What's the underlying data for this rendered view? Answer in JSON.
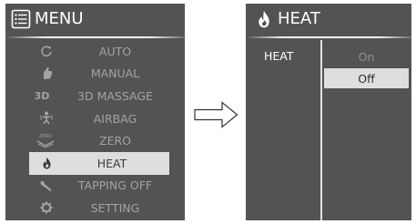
{
  "menu": {
    "title": "MENU",
    "items": [
      {
        "label": "AUTO",
        "icon": "auto-cycle-icon"
      },
      {
        "label": "MANUAL",
        "icon": "hand-icon"
      },
      {
        "label": "3D MASSAGE",
        "icon": "3d-icon",
        "icon_text": "3D"
      },
      {
        "label": "AIRBAG",
        "icon": "airbag-person-icon"
      },
      {
        "label": "ZERO",
        "icon": "zero-gravity-icon",
        "icon_text": "ZERO"
      },
      {
        "label": "HEAT",
        "icon": "flame-icon",
        "selected": true
      },
      {
        "label": "TAPPING OFF",
        "icon": "tapping-icon"
      },
      {
        "label": "SETTING",
        "icon": "gear-icon"
      }
    ]
  },
  "heat_screen": {
    "title": "HEAT",
    "label": "HEAT",
    "options": [
      {
        "label": "On",
        "selected": false
      },
      {
        "label": "Off",
        "selected": true
      }
    ]
  },
  "colors": {
    "panel_bg": "#535353",
    "selected_bg": "#dedede",
    "text_dim": "#a3a3a3",
    "text_white": "#ffffff"
  }
}
